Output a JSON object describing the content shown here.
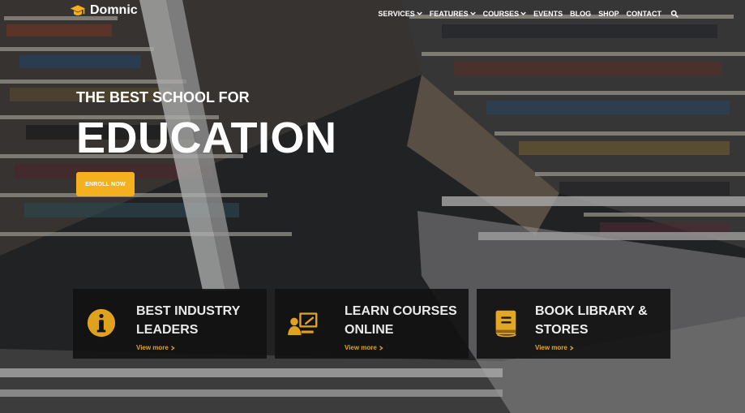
{
  "header": {
    "logo_text": "Domnic",
    "logo_icon": "graduation-cap-icon",
    "nav": [
      {
        "label": "SERVICES",
        "caret": true
      },
      {
        "label": "FEATURES",
        "caret": true
      },
      {
        "label": "COURSES",
        "caret": true
      },
      {
        "label": "EVENTS",
        "caret": false
      },
      {
        "label": "BLOG",
        "caret": false
      },
      {
        "label": "SHOP",
        "caret": false
      },
      {
        "label": "CONTACT",
        "caret": false
      }
    ],
    "search_icon": "search-icon"
  },
  "hero": {
    "kicker": "THE BEST SCHOOL FOR",
    "title": "EDUCATION",
    "enroll_label": "ENROLL NOW"
  },
  "features": [
    {
      "title_line_1": "BEST INDUSTRY",
      "title_line_2": "LEADERS",
      "link_text": "View more",
      "icon": "info-icon"
    },
    {
      "title_line_1": "LEARN COURSES",
      "title_line_2": "ONLINE",
      "link_text": "View more",
      "icon": "online-teacher-icon"
    },
    {
      "title_line_1": "BOOK LIBRARY &",
      "title_line_2": "STORES",
      "link_text": "View more",
      "icon": "book-icon"
    }
  ],
  "colors": {
    "accent": "#f4b01f",
    "card_background": "#121212",
    "text": "#ffffff"
  }
}
